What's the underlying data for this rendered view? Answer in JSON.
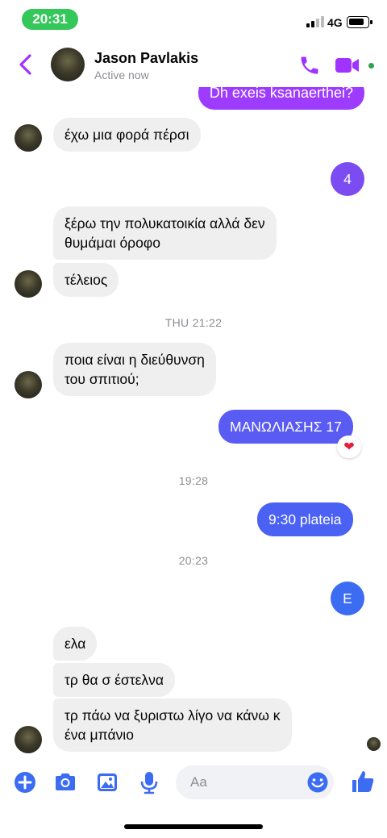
{
  "status_bar": {
    "time": "20:31",
    "network": "4G"
  },
  "header": {
    "name": "Jason Pavlakis",
    "status": "Active now"
  },
  "colors": {
    "accent": "#a033ff",
    "bubble_out_blue": "#3b6cf2",
    "bubble_out_purple": "#8a3cf6",
    "incoming": "#efefef",
    "online": "#31a24c"
  },
  "messages": [
    {
      "dir": "out",
      "text": "Dh exeis ksanaerthei?"
    },
    {
      "dir": "in",
      "text": "έχω μια φορά πέρσι"
    },
    {
      "dir": "out",
      "text": "4"
    },
    {
      "dir": "in",
      "text": "ξέρω την πολυκατοικία αλλά δεν\nθυμάμαι όροφο"
    },
    {
      "dir": "in",
      "text": "τέλειος"
    },
    {
      "dir": "ts",
      "text": "THU 21:22"
    },
    {
      "dir": "in",
      "text": "ποια είναι η διεύθυνση\nτου σπιτιού;"
    },
    {
      "dir": "out",
      "text": "ΜΑΝΩΛΙΑΣΗΣ 17",
      "reaction": "heart-icon"
    },
    {
      "dir": "ts",
      "text": "19:28"
    },
    {
      "dir": "out",
      "text": "9:30 plateia"
    },
    {
      "dir": "ts",
      "text": "20:23"
    },
    {
      "dir": "out",
      "text": "E"
    },
    {
      "dir": "in",
      "text": "ελα"
    },
    {
      "dir": "in",
      "text": "τρ θα σ έστελνα"
    },
    {
      "dir": "in",
      "text": "τρ πάω να ξυριστω λίγο να κάνω κ\nένα μπάνιο"
    }
  ],
  "composer": {
    "placeholder": "Aa",
    "icons": [
      "plus-icon",
      "camera-icon",
      "gallery-icon",
      "microphone-icon",
      "emoji-icon",
      "like-icon"
    ]
  }
}
